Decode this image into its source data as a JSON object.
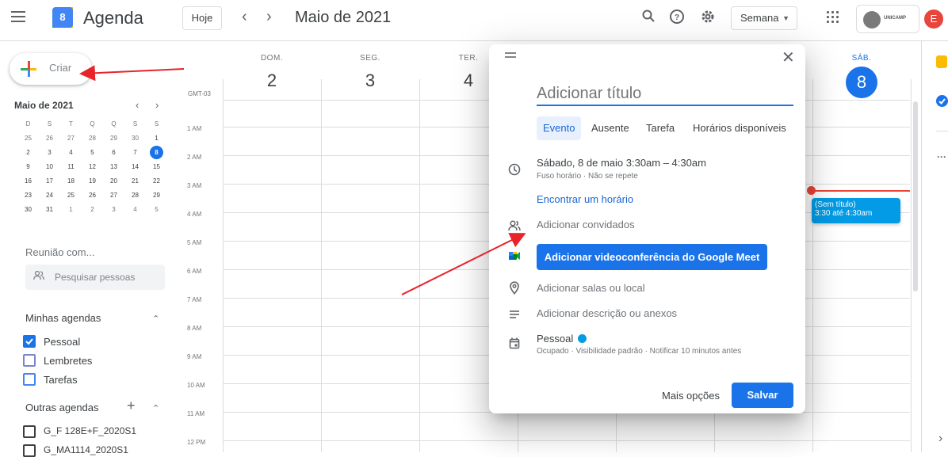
{
  "header": {
    "logo_text": "8",
    "app_title": "Agenda",
    "today_label": "Hoje",
    "prev_label": "‹",
    "next_label": "›",
    "month_title": "Maio de 2021",
    "view_label": "Semana",
    "org_label": "UNICAMP",
    "avatar_letter": "E"
  },
  "sidebar": {
    "create_label": "Criar",
    "mini_calendar": {
      "title": "Maio de 2021",
      "weekdays": [
        "D",
        "S",
        "T",
        "Q",
        "Q",
        "S",
        "S"
      ],
      "weeks": [
        [
          "25",
          "26",
          "27",
          "28",
          "29",
          "30",
          "1"
        ],
        [
          "2",
          "3",
          "4",
          "5",
          "6",
          "7",
          "8"
        ],
        [
          "9",
          "10",
          "11",
          "12",
          "13",
          "14",
          "15"
        ],
        [
          "16",
          "17",
          "18",
          "19",
          "20",
          "21",
          "22"
        ],
        [
          "23",
          "24",
          "25",
          "26",
          "27",
          "28",
          "29"
        ],
        [
          "30",
          "31",
          "1",
          "2",
          "3",
          "4",
          "5"
        ]
      ],
      "selected": "8"
    },
    "meet_title": "Reunião com...",
    "search_people_placeholder": "Pesquisar pessoas",
    "my_calendars_title": "Minhas agendas",
    "my_calendars": [
      "Pessoal",
      "Lembretes",
      "Tarefas"
    ],
    "other_calendars_title": "Outras agendas",
    "other_calendars": [
      "G_F 128E+F_2020S1",
      "G_MA1114_2020S1"
    ]
  },
  "grid": {
    "timezone": "GMT-03",
    "days": [
      {
        "name": "DOM.",
        "num": "2"
      },
      {
        "name": "SEG.",
        "num": "3"
      },
      {
        "name": "TER.",
        "num": "4"
      },
      {
        "name": "",
        "num": ""
      },
      {
        "name": "",
        "num": ""
      },
      {
        "name": "",
        "num": ""
      },
      {
        "name": "SÁB.",
        "num": "8"
      }
    ],
    "hours": [
      "1 AM",
      "2 AM",
      "3 AM",
      "4 AM",
      "5 AM",
      "6 AM",
      "7 AM",
      "8 AM",
      "9 AM",
      "10 AM",
      "11 AM",
      "12 PM"
    ],
    "event": {
      "title": "(Sem título)",
      "time": "3:30 até 4:30am"
    }
  },
  "dialog": {
    "title_placeholder": "Adicionar título",
    "tabs": [
      "Evento",
      "Ausente",
      "Tarefa",
      "Horários disponíveis"
    ],
    "date_time": "Sábado, 8 de maio   3:30am  –  4:30am",
    "date_sub": "Fuso horário · Não se repete",
    "find_time": "Encontrar um horário",
    "add_guests": "Adicionar convidados",
    "meet_button": "Adicionar videoconferência do Google Meet",
    "add_location": "Adicionar salas ou local",
    "add_description": "Adicionar descrição ou anexos",
    "calendar_name": "Pessoal",
    "calendar_sub": "Ocupado · Visibilidade padrão · Notificar 10 minutos antes",
    "more_options": "Mais opções",
    "save": "Salvar"
  },
  "colors": {
    "accent": "#1a73e8",
    "event": "#039be5",
    "now_line": "#ea4335",
    "annotation_arrow": "#e8232a"
  }
}
